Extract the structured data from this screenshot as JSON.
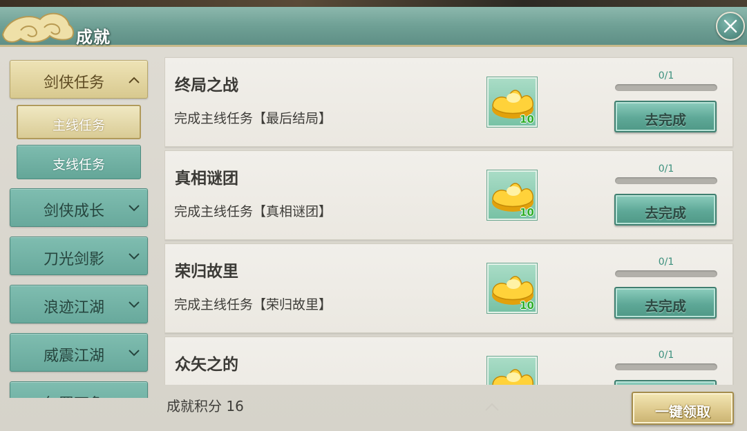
{
  "window": {
    "title": "成就",
    "close_icon": "close-icon"
  },
  "colors": {
    "teal_button": "#68a99c",
    "gold_active": "#d8c98f",
    "title_bar": "#6fa095",
    "reward_qty": "#2fae2a"
  },
  "sidebar": {
    "categories": [
      {
        "label": "剑侠任务",
        "icon": "chevron-up-icon",
        "active": true
      },
      {
        "label": "剑侠成长",
        "icon": "chevron-down-icon",
        "active": false
      },
      {
        "label": "刀光剑影",
        "icon": "chevron-down-icon",
        "active": false
      },
      {
        "label": "浪迹江湖",
        "icon": "chevron-down-icon",
        "active": false
      },
      {
        "label": "威震江湖",
        "icon": "chevron-down-icon",
        "active": false
      },
      {
        "label": "包罗万象",
        "icon": "chevron-down-icon",
        "active": false
      }
    ],
    "subitems": [
      {
        "label": "主线任务",
        "active": true
      },
      {
        "label": "支线任务",
        "active": false
      }
    ]
  },
  "achievements": [
    {
      "name": "终局之战",
      "desc": "完成主线任务【最后结局】",
      "reward_icon": "gold-ingot-icon",
      "reward_qty": "10",
      "progress_text": "0/1",
      "progress": 0,
      "button": "去完成"
    },
    {
      "name": "真相谜团",
      "desc": "完成主线任务【真相谜团】",
      "reward_icon": "gold-ingot-icon",
      "reward_qty": "10",
      "progress_text": "0/1",
      "progress": 0,
      "button": "去完成"
    },
    {
      "name": "荣归故里",
      "desc": "完成主线任务【荣归故里】",
      "reward_icon": "gold-ingot-icon",
      "reward_qty": "10",
      "progress_text": "0/1",
      "progress": 0,
      "button": "去完成"
    },
    {
      "name": "众矢之的",
      "desc": "",
      "reward_icon": "gold-ingot-icon",
      "reward_qty": "",
      "progress_text": "0/1",
      "progress": 0,
      "button": ""
    }
  ],
  "footer": {
    "score_label": "成就积分 16",
    "claim_all_button": "一键领取"
  }
}
